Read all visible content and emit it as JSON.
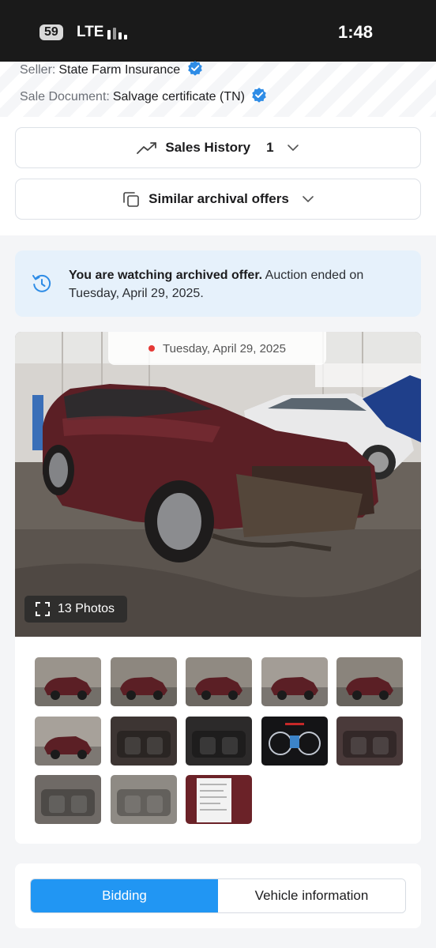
{
  "status_bar": {
    "battery": "59",
    "network": "LTE",
    "time": "1:48"
  },
  "seller": {
    "label": "Seller:",
    "value": "State Farm Insurance"
  },
  "sale_document": {
    "label": "Sale Document:",
    "value": "Salvage certificate (TN)"
  },
  "sales_history": {
    "label": "Sales History",
    "count": "1"
  },
  "similar_offers": {
    "label": "Similar archival offers"
  },
  "archive_notice": {
    "bold": "You are watching archived offer.",
    "text": " Auction ended on Tuesday, April 29, 2025."
  },
  "photo": {
    "date": "Tuesday, April 29, 2025",
    "photos_label": "13 Photos",
    "car_color": "#5b1f25"
  },
  "thumbnails": [
    {
      "name": "thumb-front-left-1",
      "bg": "#9a948c"
    },
    {
      "name": "thumb-front-left-2",
      "bg": "#8d877f"
    },
    {
      "name": "thumb-rear-left",
      "bg": "#908a82"
    },
    {
      "name": "thumb-front-right",
      "bg": "#a39d96"
    },
    {
      "name": "thumb-front",
      "bg": "#8a847c"
    },
    {
      "name": "thumb-rear",
      "bg": "#a7a19a"
    },
    {
      "name": "thumb-interior-front",
      "bg": "#3d3533"
    },
    {
      "name": "thumb-dashboard",
      "bg": "#2c2a2a"
    },
    {
      "name": "thumb-gauges",
      "bg": "#141416"
    },
    {
      "name": "thumb-rear-seats",
      "bg": "#4a3a3a"
    },
    {
      "name": "thumb-engine",
      "bg": "#6f6a66"
    },
    {
      "name": "thumb-debris",
      "bg": "#8e8a84"
    },
    {
      "name": "thumb-label",
      "bg": "#6b2228"
    }
  ],
  "tabs": {
    "bidding": "Bidding",
    "vehicle_info": "Vehicle information"
  },
  "colors": {
    "accent": "#2196f3",
    "verified": "#2e8ce6",
    "live_dot": "#e53935"
  }
}
